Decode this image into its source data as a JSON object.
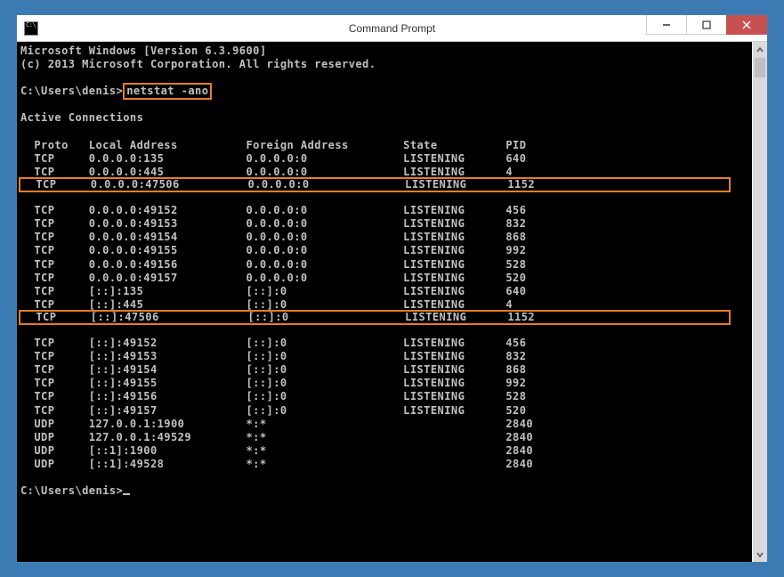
{
  "window": {
    "title": "Command Prompt"
  },
  "banner": {
    "line1": "Microsoft Windows [Version 6.3.9600]",
    "line2": "(c) 2013 Microsoft Corporation. All rights reserved."
  },
  "prompt_path": "C:\\Users\\denis>",
  "command": "netstat -ano",
  "section_title": "Active Connections",
  "columns": {
    "col1": "Proto",
    "col2": "Local Address",
    "col3": "Foreign Address",
    "col4": "State",
    "col5": "PID"
  },
  "rows": [
    {
      "proto": "TCP",
      "local": "0.0.0.0:135",
      "foreign": "0.0.0.0:0",
      "state": "LISTENING",
      "pid": "640",
      "highlight": false
    },
    {
      "proto": "TCP",
      "local": "0.0.0.0:445",
      "foreign": "0.0.0.0:0",
      "state": "LISTENING",
      "pid": "4",
      "highlight": false
    },
    {
      "proto": "TCP",
      "local": "0.0.0.0:47506",
      "foreign": "0.0.0.0:0",
      "state": "LISTENING",
      "pid": "1152",
      "highlight": true
    },
    {
      "proto": "TCP",
      "local": "0.0.0.0:49152",
      "foreign": "0.0.0.0:0",
      "state": "LISTENING",
      "pid": "456",
      "highlight": false
    },
    {
      "proto": "TCP",
      "local": "0.0.0.0:49153",
      "foreign": "0.0.0.0:0",
      "state": "LISTENING",
      "pid": "832",
      "highlight": false
    },
    {
      "proto": "TCP",
      "local": "0.0.0.0:49154",
      "foreign": "0.0.0.0:0",
      "state": "LISTENING",
      "pid": "868",
      "highlight": false
    },
    {
      "proto": "TCP",
      "local": "0.0.0.0:49155",
      "foreign": "0.0.0.0:0",
      "state": "LISTENING",
      "pid": "992",
      "highlight": false
    },
    {
      "proto": "TCP",
      "local": "0.0.0.0:49156",
      "foreign": "0.0.0.0:0",
      "state": "LISTENING",
      "pid": "528",
      "highlight": false
    },
    {
      "proto": "TCP",
      "local": "0.0.0.0:49157",
      "foreign": "0.0.0.0:0",
      "state": "LISTENING",
      "pid": "520",
      "highlight": false
    },
    {
      "proto": "TCP",
      "local": "[::]:135",
      "foreign": "[::]:0",
      "state": "LISTENING",
      "pid": "640",
      "highlight": false
    },
    {
      "proto": "TCP",
      "local": "[::]:445",
      "foreign": "[::]:0",
      "state": "LISTENING",
      "pid": "4",
      "highlight": false
    },
    {
      "proto": "TCP",
      "local": "[::]:47506",
      "foreign": "[::]:0",
      "state": "LISTENING",
      "pid": "1152",
      "highlight": true
    },
    {
      "proto": "TCP",
      "local": "[::]:49152",
      "foreign": "[::]:0",
      "state": "LISTENING",
      "pid": "456",
      "highlight": false
    },
    {
      "proto": "TCP",
      "local": "[::]:49153",
      "foreign": "[::]:0",
      "state": "LISTENING",
      "pid": "832",
      "highlight": false
    },
    {
      "proto": "TCP",
      "local": "[::]:49154",
      "foreign": "[::]:0",
      "state": "LISTENING",
      "pid": "868",
      "highlight": false
    },
    {
      "proto": "TCP",
      "local": "[::]:49155",
      "foreign": "[::]:0",
      "state": "LISTENING",
      "pid": "992",
      "highlight": false
    },
    {
      "proto": "TCP",
      "local": "[::]:49156",
      "foreign": "[::]:0",
      "state": "LISTENING",
      "pid": "528",
      "highlight": false
    },
    {
      "proto": "TCP",
      "local": "[::]:49157",
      "foreign": "[::]:0",
      "state": "LISTENING",
      "pid": "520",
      "highlight": false
    },
    {
      "proto": "UDP",
      "local": "127.0.0.1:1900",
      "foreign": "*:*",
      "state": "",
      "pid": "2840",
      "highlight": false
    },
    {
      "proto": "UDP",
      "local": "127.0.0.1:49529",
      "foreign": "*:*",
      "state": "",
      "pid": "2840",
      "highlight": false
    },
    {
      "proto": "UDP",
      "local": "[::1]:1900",
      "foreign": "*:*",
      "state": "",
      "pid": "2840",
      "highlight": false
    },
    {
      "proto": "UDP",
      "local": "[::1]:49528",
      "foreign": "*:*",
      "state": "",
      "pid": "2840",
      "highlight": false
    }
  ]
}
